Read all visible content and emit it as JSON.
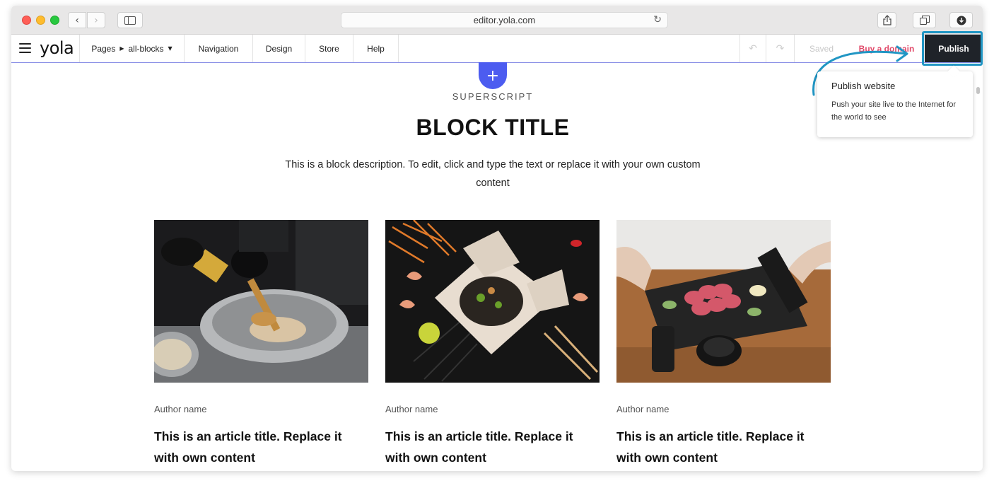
{
  "browser": {
    "address": "editor.yola.com",
    "back_icon": "‹",
    "forward_icon": "›",
    "reload_icon": "↻"
  },
  "toolbar": {
    "logo": "yola",
    "pages_label": "Pages",
    "page_name": "all-blocks",
    "navigation": "Navigation",
    "design": "Design",
    "store": "Store",
    "help": "Help",
    "undo_icon": "↶",
    "redo_icon": "↷",
    "saved": "Saved",
    "buy_domain": "Buy a domain",
    "publish": "Publish"
  },
  "tooltip": {
    "title": "Publish website",
    "text": "Push your site live to the Internet for the world to see"
  },
  "block": {
    "add_icon": "+",
    "superscript": "SUPERSCRIPT",
    "title": "BLOCK TITLE",
    "description": "This is a block description. To edit, click and type the text or replace it with your own custom content"
  },
  "cards": [
    {
      "author": "Author name",
      "title": "This is an article title. Replace it with own content"
    },
    {
      "author": "Author name",
      "title": "This is an article title. Replace it with own content"
    },
    {
      "author": "Author name",
      "title": "This is an article title. Replace it with own content"
    }
  ],
  "colors": {
    "accent": "#4c5cf0",
    "publish_bg": "#1f2329",
    "buy_domain": "#e14a6a",
    "highlight_ring": "#2196c4"
  }
}
